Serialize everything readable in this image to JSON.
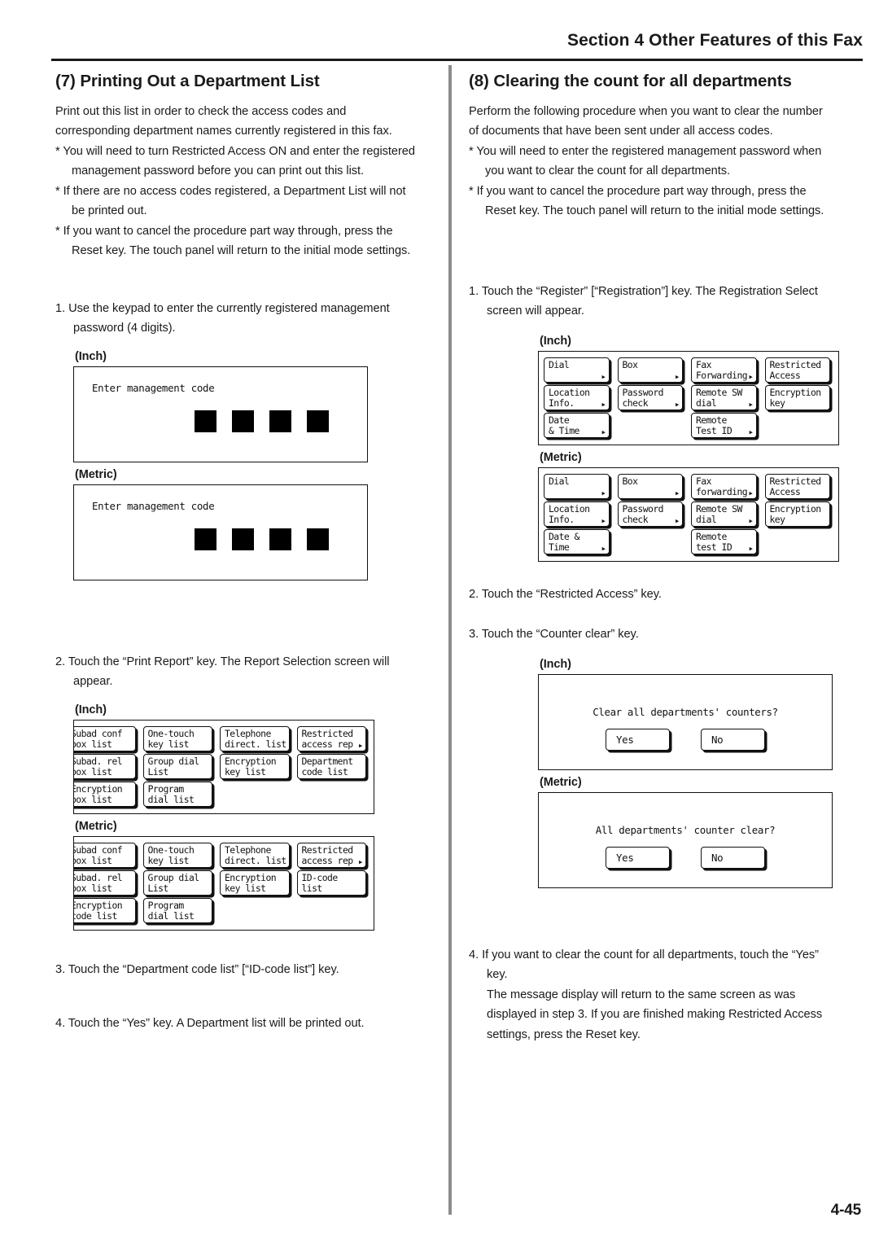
{
  "header": {
    "section_title": "Section 4 Other Features of this Fax"
  },
  "page_number": "4-45",
  "left_column": {
    "heading": "(7) Printing Out a Department List",
    "intro_line1": "Print out this list in order to check the access codes and",
    "intro_line2": "corresponding department names currently registered in this fax.",
    "notes": [
      {
        "marker": "*",
        "line1": "You will need to turn Restricted Access ON and enter the registered",
        "line2": "management password before you can print out this list."
      },
      {
        "marker": "*",
        "line1": "If there are no access codes registered, a Department List will not",
        "line2": "be printed out."
      },
      {
        "marker": "*",
        "line1": "If you want to cancel the procedure part way through, press the",
        "line2": "Reset key. The touch panel will return to the initial mode settings."
      }
    ],
    "step1": {
      "number": "1.",
      "line1": "Use the keypad to enter the currently registered management",
      "line2": "password (4 digits)."
    },
    "figure_password": {
      "inch_label": "(Inch)",
      "metric_label": "(Metric)",
      "inch_prompt": "Enter management code",
      "metric_prompt": "Enter management code",
      "digit_count": 4
    },
    "step2": {
      "number": "2.",
      "line1": "Touch the “Print Report” key. The Report Selection screen will",
      "line2": "appear."
    },
    "figure_report": {
      "inch_label": "(Inch)",
      "metric_label": "(Metric)",
      "inch_keys": [
        [
          {
            "line1": "Subad conf",
            "line2": "box list",
            "arrow": false
          },
          {
            "line1": "One-touch",
            "line2": "key list",
            "arrow": false
          },
          {
            "line1": "Telephone",
            "line2": "direct. list",
            "arrow": false
          },
          {
            "line1": "Restricted",
            "line2": "access rep",
            "arrow": true
          }
        ],
        [
          {
            "line1": "Subad. rel",
            "line2": "box list",
            "arrow": false
          },
          {
            "line1": "Group dial",
            "line2": "List",
            "arrow": false
          },
          {
            "line1": "Encryption",
            "line2": "key list",
            "arrow": false
          },
          {
            "line1": "Department",
            "line2": "code list",
            "arrow": false
          }
        ],
        [
          {
            "line1": "Encryption",
            "line2": "box list",
            "arrow": false
          },
          {
            "line1": "Program",
            "line2": "dial list",
            "arrow": false
          },
          {
            "empty": true
          },
          {
            "empty": true
          }
        ]
      ],
      "metric_keys": [
        [
          {
            "line1": "Subad conf",
            "line2": "box list",
            "arrow": false
          },
          {
            "line1": "One-touch",
            "line2": "key list",
            "arrow": false
          },
          {
            "line1": "Telephone",
            "line2": "direct. list",
            "arrow": false
          },
          {
            "line1": "Restricted",
            "line2": "access rep",
            "arrow": true
          }
        ],
        [
          {
            "line1": "Subad. rel",
            "line2": "box list",
            "arrow": false
          },
          {
            "line1": "Group dial",
            "line2": "List",
            "arrow": false
          },
          {
            "line1": "Encryption",
            "line2": "key list",
            "arrow": false
          },
          {
            "line1": "ID-code",
            "line2": "list",
            "arrow": false
          }
        ],
        [
          {
            "line1": "Encryption",
            "line2": "code list",
            "arrow": false
          },
          {
            "line1": "Program",
            "line2": "dial list",
            "arrow": false
          },
          {
            "empty": true
          },
          {
            "empty": true
          }
        ]
      ]
    },
    "step3": {
      "number": "3.",
      "line1": "Touch the “Department code list” [“ID-code list”] key."
    },
    "step4": {
      "number": "4.",
      "line1": "Touch the “Yes” key. A Department list will be printed out."
    }
  },
  "right_column": {
    "heading": "(8) Clearing the count for all departments",
    "intro_line1": "Perform the following procedure when you want to clear the number",
    "intro_line2": "of documents that have been sent under all access codes.",
    "notes": [
      {
        "marker": "*",
        "line1": "You will need to enter the registered management password when",
        "line2": "you want to clear the count for all departments."
      },
      {
        "marker": "*",
        "line1": "If you want to cancel the procedure part way through, press the",
        "line2": "Reset key. The touch panel will return to the initial mode settings."
      }
    ],
    "step1": {
      "number": "1.",
      "line1": "Touch the “Register” [“Registration”] key. The Registration Select",
      "line2": "screen will appear."
    },
    "figure_registration": {
      "inch_label": "(Inch)",
      "metric_label": "(Metric)",
      "inch_keys": [
        [
          {
            "line1": "Dial",
            "line2": "",
            "arrow": true
          },
          {
            "line1": "Box",
            "line2": "",
            "arrow": true
          },
          {
            "line1": "Fax",
            "line2": "Forwarding",
            "arrow": true
          },
          {
            "line1": "Restricted",
            "line2": "Access",
            "arrow": false
          }
        ],
        [
          {
            "line1": "Location",
            "line2": "Info.",
            "arrow": true
          },
          {
            "line1": "Password",
            "line2": "check",
            "arrow": true
          },
          {
            "line1": "Remote SW",
            "line2": "dial",
            "arrow": true
          },
          {
            "line1": "Encryption",
            "line2": "key",
            "arrow": false
          }
        ],
        [
          {
            "line1": "Date",
            "line2": "& Time",
            "arrow": true
          },
          {
            "empty": true
          },
          {
            "line1": "Remote",
            "line2": "Test ID",
            "arrow": true
          },
          {
            "empty": true
          }
        ]
      ],
      "metric_keys": [
        [
          {
            "line1": "Dial",
            "line2": "",
            "arrow": true
          },
          {
            "line1": "Box",
            "line2": "",
            "arrow": true
          },
          {
            "line1": "Fax",
            "line2": "forwarding",
            "arrow": true
          },
          {
            "line1": "Restricted",
            "line2": "Access",
            "arrow": false
          }
        ],
        [
          {
            "line1": "Location",
            "line2": "Info.",
            "arrow": true
          },
          {
            "line1": "Password",
            "line2": "check",
            "arrow": true
          },
          {
            "line1": "Remote SW",
            "line2": "dial",
            "arrow": true
          },
          {
            "line1": "Encryption",
            "line2": "key",
            "arrow": false
          }
        ],
        [
          {
            "line1": "Date &",
            "line2": "Time",
            "arrow": true
          },
          {
            "empty": true
          },
          {
            "line1": "Remote",
            "line2": "test ID",
            "arrow": true
          },
          {
            "empty": true
          }
        ]
      ]
    },
    "step2": {
      "number": "2.",
      "line1": "Touch the “Restricted Access” key."
    },
    "step3": {
      "number": "3.",
      "line1": "Touch the “Counter clear” key."
    },
    "figure_confirm": {
      "inch_label": "(Inch)",
      "metric_label": "(Metric)",
      "inch_question": "Clear all departments' counters?",
      "metric_question": "All departments' counter clear?",
      "yes_label": "Yes",
      "no_label": "No"
    },
    "step4": {
      "number": "4.",
      "line1": "If you want to clear the count for all departments, touch the “Yes”",
      "line2": "key.",
      "line3": "The message display will return to the same screen as was",
      "line4": "displayed in step 3. If you are finished making Restricted Access",
      "line5": "settings, press the Reset key."
    }
  }
}
